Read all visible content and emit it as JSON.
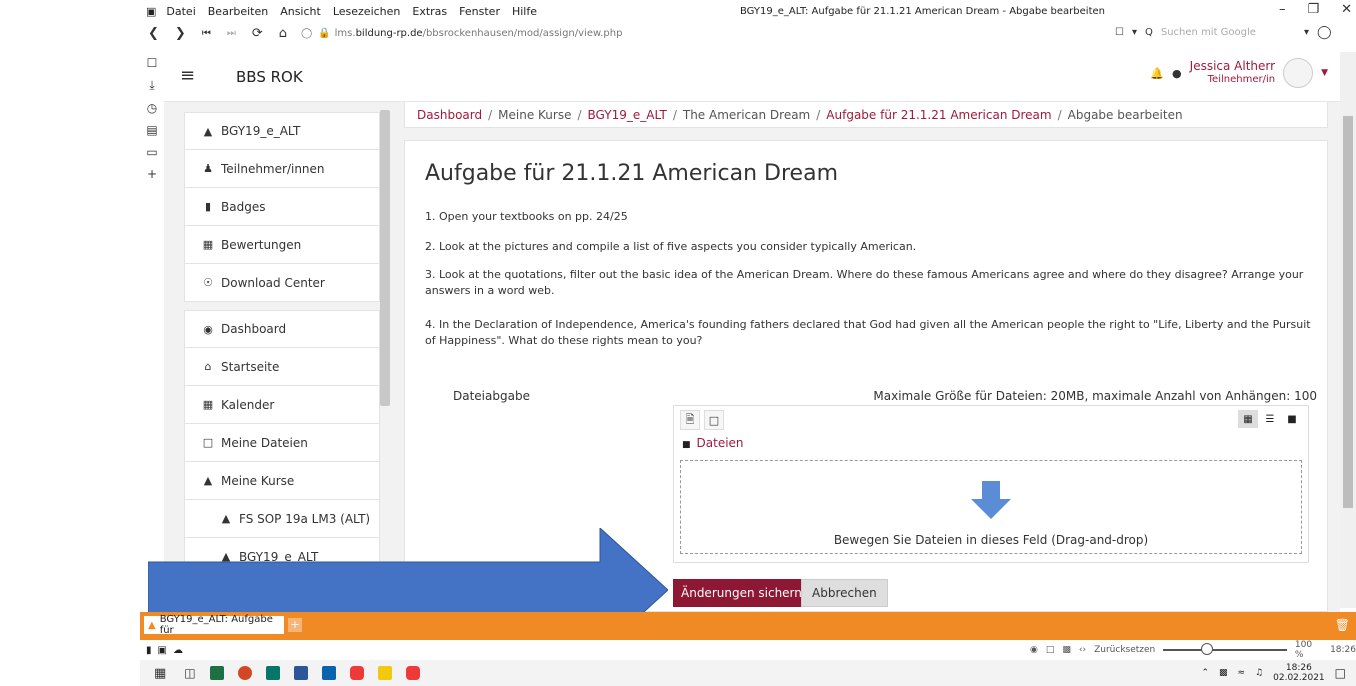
{
  "browser": {
    "menu": [
      "Datei",
      "Bearbeiten",
      "Ansicht",
      "Lesezeichen",
      "Extras",
      "Fenster",
      "Hilfe"
    ],
    "window_title": "BGY19_e_ALT: Aufgabe für 21.1.21 American Dream - Abgabe bearbeiten",
    "url_prefix": "lms.",
    "url_domain": "bildung-rp.de",
    "url_path": "/bbsrockenhausen/mod/assign/view.php",
    "search_placeholder": "Suchen mit Google"
  },
  "header": {
    "brand": "BBS ROK",
    "user_name": "Jessica Altherr",
    "user_role": "Teilnehmer/in"
  },
  "nav": {
    "items": [
      {
        "label": "BGY19_e_ALT",
        "icon": "graduation-cap-icon"
      },
      {
        "label": "Teilnehmer/innen",
        "icon": "users-icon"
      },
      {
        "label": "Badges",
        "icon": "shield-icon"
      },
      {
        "label": "Bewertungen",
        "icon": "table-icon"
      },
      {
        "label": "Download Center",
        "icon": "download-icon"
      },
      {
        "label": "Dashboard",
        "icon": "dashboard-icon"
      },
      {
        "label": "Startseite",
        "icon": "home-icon"
      },
      {
        "label": "Kalender",
        "icon": "calendar-icon"
      },
      {
        "label": "Meine Dateien",
        "icon": "file-icon"
      },
      {
        "label": "Meine Kurse",
        "icon": "graduation-cap-icon"
      },
      {
        "label": "FS SOP 19a LM3 (ALT)",
        "icon": "graduation-cap-icon"
      },
      {
        "label": "BGY19_e_ALT",
        "icon": "graduation-cap-icon"
      }
    ]
  },
  "breadcrumb": [
    "Dashboard",
    "Meine Kurse",
    "BGY19_e_ALT",
    "The American Dream",
    "Aufgabe für 21.1.21 American Dream",
    "Abgabe bearbeiten"
  ],
  "assignment": {
    "title": "Aufgabe für 21.1.21 American Dream",
    "p1": "1. Open your textbooks on pp. 24/25",
    "p2": "2. Look at the pictures and compile a list of five aspects you consider typically American.",
    "p3": "3. Look at the quotations, filter out the basic idea of the American Dream. Where do these famous Americans agree and where do they disagree? Arrange your answers in a word web.",
    "p4": "4. In the Declaration of Independence, America's founding fathers declared that God had given all the American people the right to \"Life, Liberty and the Pursuit of Happiness\". What do these rights mean to you?"
  },
  "upload": {
    "label": "Dateiabgabe",
    "max": "Maximale Größe für Dateien: 20MB, maximale Anzahl von Anhängen: 100",
    "folder": "Dateien",
    "drop_text": "Bewegen Sie Dateien in dieses Feld (Drag-and-drop)"
  },
  "buttons": {
    "save": "Änderungen sichern",
    "cancel": "Abbrechen"
  },
  "tabbar": {
    "tab_label": "BGY19_e_ALT: Aufgabe für"
  },
  "statusbar": {
    "reset": "Zurücksetzen",
    "zoom": "100 %",
    "time": "18:26"
  },
  "taskbar": {
    "time": "18:26",
    "date": "02.02.2021"
  },
  "colors": {
    "accent": "#a01a3c",
    "save_button": "#8e1733",
    "overlay_arrow": "#4472c4",
    "tabbar": "#f08a24"
  }
}
